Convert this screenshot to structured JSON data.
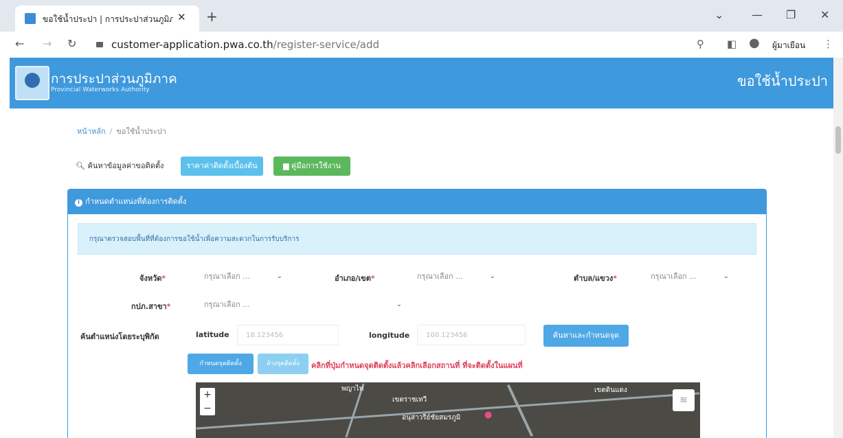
{
  "browser": {
    "tab_title": "ขอใช้น้ำประปา | การประปาส่วนภูมิภา",
    "tab_close": "✕",
    "new_tab": "+",
    "url_domain": "customer-application.pwa.co.th",
    "url_path": "/register-service/add",
    "profile_name": "ผู้มาเยือน"
  },
  "header": {
    "brand_th": "การประปาส่วนภูมิภาค",
    "brand_en": "Provincial Waterworks Authority",
    "page_title": "ขอใช้น้ำประปา"
  },
  "breadcrumb": {
    "home": "หน้าหลัก",
    "current": "ขอใช้น้ำประปา"
  },
  "actions": {
    "search_label": "ค้นหาข้อมูลค่าขอติดตั้ง",
    "price_button": "ราคาค่าติดตั้งเบื้องต้น",
    "manual_button": "คู่มือการใช้งาน"
  },
  "panel": {
    "title": "กำหนดตำแหน่งที่ต้องการติดตั้ง",
    "alert": "กรุณาตรวจสอบพื้นที่ที่ต้องการขอใช้น้ำเพื่อความสะดวกในการรับบริการ"
  },
  "form": {
    "province_label": "จังหวัด",
    "district_label": "อำเภอ/เขต",
    "subdistrict_label": "ตำบล/แขวง",
    "branch_label": "กปภ.สาขา",
    "select_placeholder": "กรุณาเลือก ...",
    "coords_label": "ค้นตำแหน่งโดยระบุพิกัด",
    "latitude_label": "latitude",
    "latitude_placeholder": "18.123456",
    "longitude_label": "longitude",
    "longitude_placeholder": "100.123456",
    "search_pin_button": "ค้นหาและกำหนดจุด",
    "set_pin_button": "กำหนดจุดติดตั้ง",
    "clear_pin_button": "ล้างจุดติดตั้ง",
    "hint": "คลิกที่ปุ่มกำหนดจุดติดตั้งแล้วคลิกเลือกสถานที่ ที่จะติดตั้งในแผนที่"
  },
  "map": {
    "zoom_in": "+",
    "zoom_out": "−",
    "labels": [
      "พญาไท",
      "เขตราชเทวี",
      "เขตดินแดง",
      "อนุสาวรีย์ชัยสมรภูมิ"
    ]
  },
  "colors": {
    "brand": "#3e99dd",
    "info_button": "#5bc0eb",
    "success_button": "#5cb85c",
    "hint_text": "#e0405a"
  }
}
